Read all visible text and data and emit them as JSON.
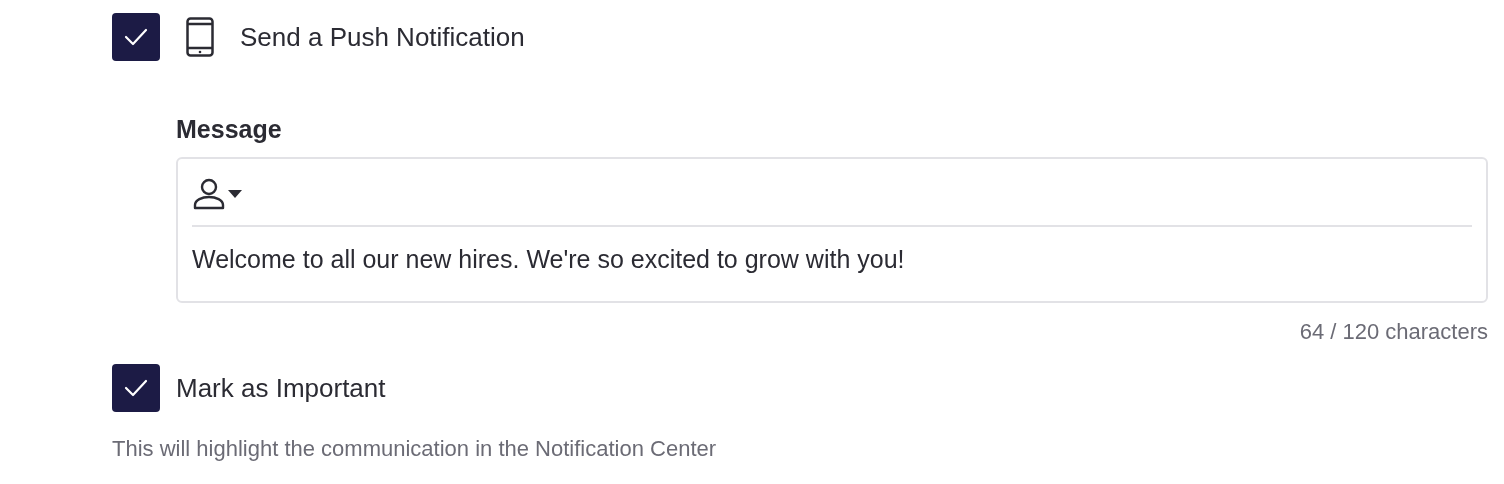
{
  "push_notification": {
    "label": "Send a Push Notification",
    "checked": true
  },
  "message": {
    "label": "Message",
    "value": "Welcome to all our new hires. We're so excited to grow with you!",
    "counter": "64 / 120 characters"
  },
  "important": {
    "label": "Mark as Important",
    "checked": true,
    "hint": "This will highlight the communication in the Notification Center"
  }
}
